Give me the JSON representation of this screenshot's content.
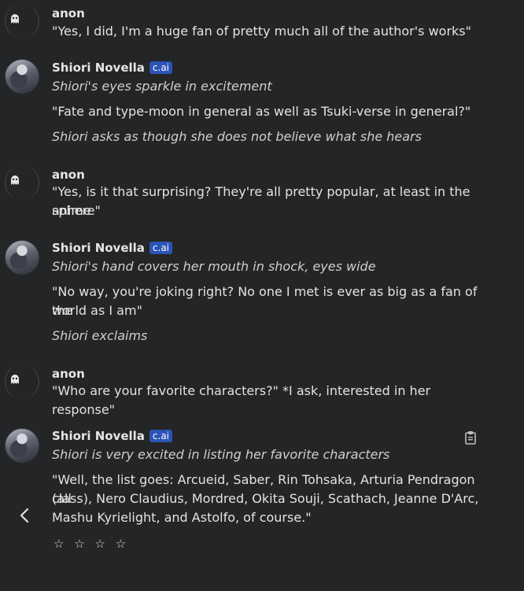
{
  "messages": [
    {
      "author": "anon",
      "lines": [
        "\"Yes, I did, I'm a huge fan of pretty much all of the author's works\""
      ]
    },
    {
      "author": "Shiori Novella",
      "badge": "c.ai",
      "lines": [
        "Shiori's eyes sparkle in excitement",
        "\"Fate and type-moon in general as well as Tsuki-verse in general?\"",
        "Shiori asks as though she does not believe what she hears"
      ]
    },
    {
      "author": "anon",
      "lines": [
        "\"Yes, is it that surprising? They're all pretty popular, at least in the anime",
        "sphere\""
      ]
    },
    {
      "author": "Shiori Novella",
      "badge": "c.ai",
      "lines": [
        "Shiori's hand covers her mouth in shock, eyes wide",
        "\"No way, you're joking right? No one I met is ever as big as a fan of the",
        "world as I am\"",
        "Shiori exclaims"
      ]
    },
    {
      "author": "anon",
      "lines": [
        "\"Who are your favorite characters?\" *I ask, interested in her response\""
      ]
    },
    {
      "author": "Shiori Novella",
      "badge": "c.ai",
      "lines": [
        "Shiori is very excited in listing her favorite characters",
        "\"Well, the list goes: Arcueid, Saber, Rin Tohsaka, Arturia Pendragon (all",
        "class), Nero Claudius, Mordred, Okita Souji, Scathach, Jeanne D'Arc,",
        "Mashu Kyrielight, and Astolfo, of course.\""
      ]
    }
  ],
  "rating": {
    "stars": [
      "☆",
      "☆",
      "☆",
      "☆"
    ]
  },
  "icons": {
    "user_avatar": "ghost-icon",
    "back": "chevron-left-icon",
    "copy": "clipboard-icon"
  }
}
